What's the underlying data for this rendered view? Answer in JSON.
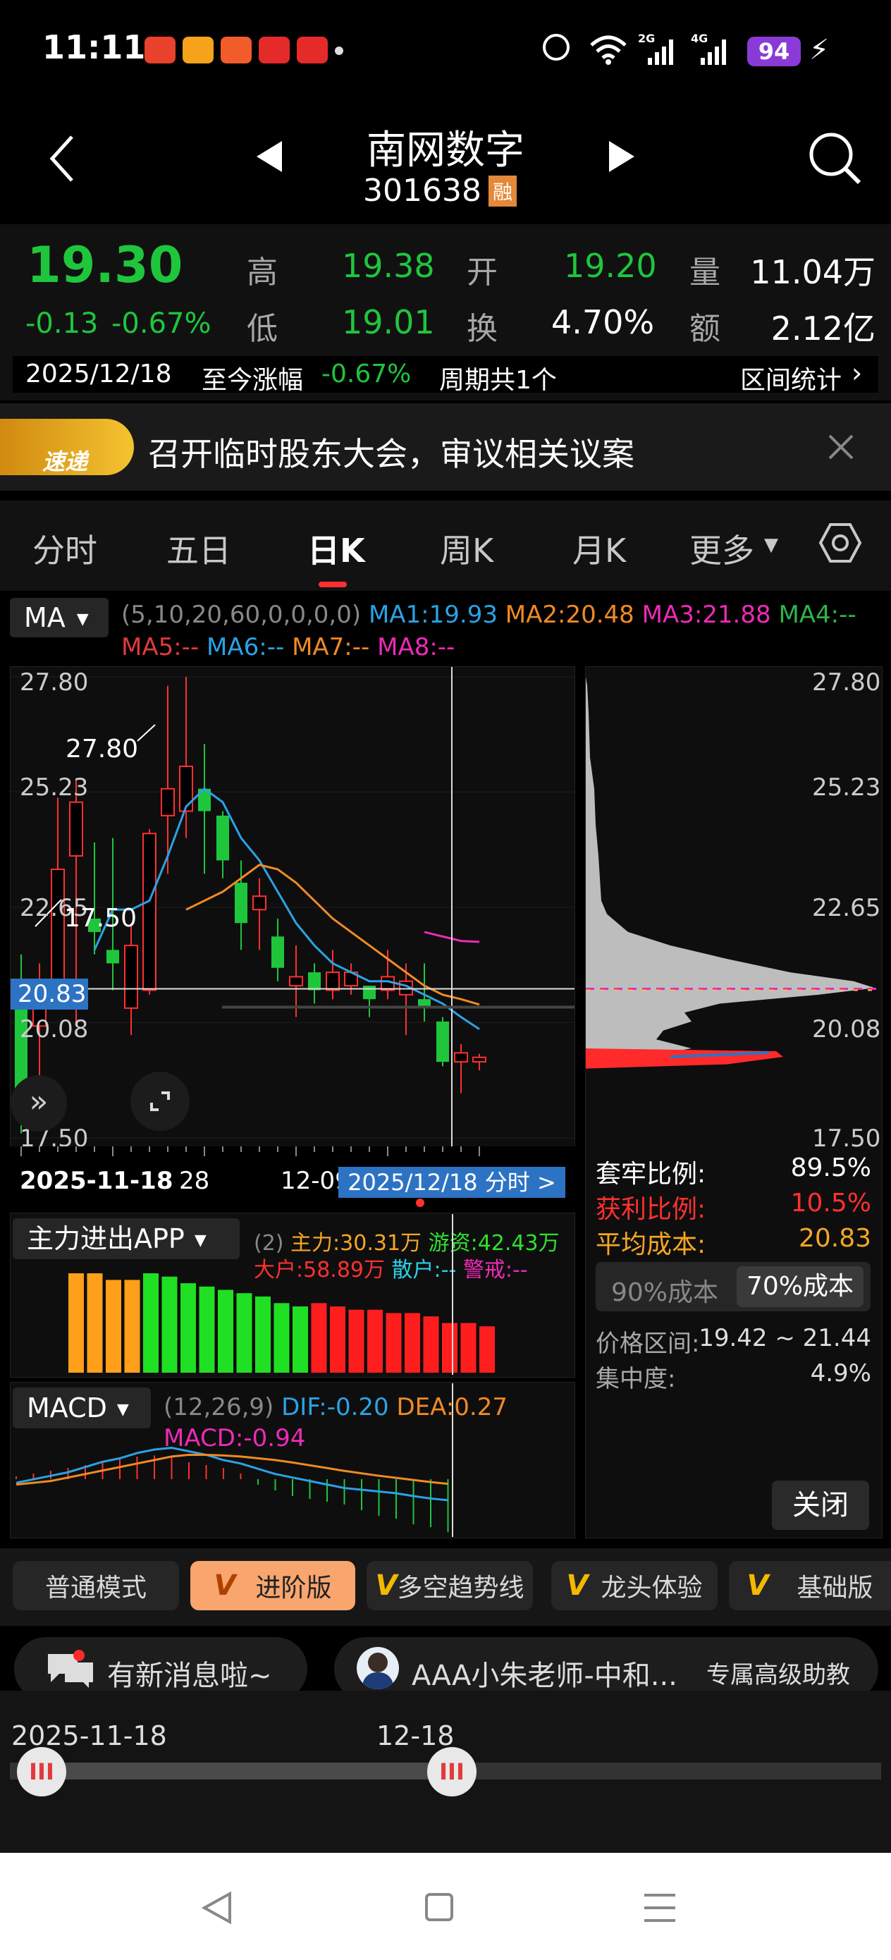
{
  "status_bar": {
    "time": "11:11",
    "battery": "94"
  },
  "header": {
    "name": "南网数字",
    "code": "301638",
    "rong_badge": "融"
  },
  "quote": {
    "price": "19.30",
    "change": "-0.13",
    "change_pct": "-0.67%",
    "high_label": "高",
    "high": "19.38",
    "open_label": "开",
    "open": "19.20",
    "vol_label": "量",
    "vol": "11.04万",
    "low_label": "低",
    "low": "19.01",
    "turnover_label": "换",
    "turnover": "4.70%",
    "amount_label": "额",
    "amount": "2.12亿"
  },
  "period_bar": {
    "date": "2025/12/18",
    "label": "至今涨幅",
    "pct": "-0.67%",
    "count": "周期共1个",
    "stats": "区间统计"
  },
  "news": {
    "logo": "速递",
    "text": "召开临时股东大会，审议相关议案"
  },
  "tabs": [
    "分时",
    "五日",
    "日K",
    "周K",
    "月K",
    "更多"
  ],
  "active_tab": "日K",
  "ma": {
    "selector": "MA",
    "params": "(5,10,20,60,0,0,0,0)",
    "ma1": "MA1:19.93",
    "ma2": "MA2:20.48",
    "ma3": "MA3:21.88",
    "ma4": "MA4:--",
    "ma5": "MA5:--",
    "ma6": "MA6:--",
    "ma7": "MA7:--",
    "ma8": "MA8:--"
  },
  "kchart": {
    "y_labels": [
      "27.80",
      "25.23",
      "22.65",
      "20.08",
      "17.50"
    ],
    "cross_price": "20.83",
    "max_annot": "27.80",
    "min_annot": "17.50",
    "date_start": "2025-11-18",
    "date_mid": "28",
    "date_dec": "12-09",
    "cursor_tag": "2025/12/18 分时 >"
  },
  "chips": {
    "y_labels": [
      "27.80",
      "25.23",
      "22.65",
      "20.08",
      "17.50"
    ],
    "tao_label": "套牢比例:",
    "tao": "89.5%",
    "profit_label": "获利比例:",
    "profit": "10.5%",
    "avg_label": "平均成本:",
    "avg": "20.83",
    "btn90": "90%成本",
    "btn70": "70%成本",
    "range_label": "价格区间:",
    "range": "19.42 ~ 21.44",
    "conc_label": "集中度:",
    "conc": "4.9%",
    "close": "关闭"
  },
  "funds": {
    "selector": "主力进出APP",
    "param": "(2)",
    "main": "主力:30.31万",
    "hot": "游资:42.43万",
    "big": "大户:58.89万",
    "retail": "散户:--",
    "warn": "警戒:--"
  },
  "macd": {
    "selector": "MACD",
    "param": "(12,26,9)",
    "dif": "DIF:-0.20",
    "dea": "DEA:0.27",
    "macd": "MACD:-0.94"
  },
  "modes": [
    "普通模式",
    "进阶版",
    "多空趋势线",
    "龙头体验",
    "基础版"
  ],
  "msg": {
    "notice": "有新消息啦~",
    "teacher": "AAA小朱老师-中和...",
    "assistant": "专属高级助教"
  },
  "range_slider": {
    "start": "2025-11-18",
    "end": "12-18"
  },
  "chart_data": [
    {
      "type": "candlestick",
      "title": "日K",
      "ylim": [
        17.5,
        27.8
      ],
      "y_ticks": [
        27.8,
        25.23,
        22.65,
        20.08,
        17.5
      ],
      "x_labels": [
        "2025-11-18",
        "28",
        "12-09"
      ],
      "candles": [
        {
          "o": 20.4,
          "c": 18.2,
          "h": 21.6,
          "l": 17.6
        },
        {
          "o": 20.0,
          "c": 20.7,
          "h": 21.4,
          "l": 17.7
        },
        {
          "o": 20.8,
          "c": 23.5,
          "h": 25.1,
          "l": 20.4
        },
        {
          "o": 23.8,
          "c": 25.0,
          "h": 25.5,
          "l": 20.0
        },
        {
          "o": 22.4,
          "c": 22.1,
          "h": 24.1,
          "l": 21.6
        },
        {
          "o": 21.7,
          "c": 21.4,
          "h": 24.2,
          "l": 20.8
        },
        {
          "o": 20.4,
          "c": 21.8,
          "h": 22.3,
          "l": 19.8
        },
        {
          "o": 20.8,
          "c": 24.3,
          "h": 24.4,
          "l": 20.7
        },
        {
          "o": 24.7,
          "c": 25.3,
          "h": 27.6,
          "l": 23.4
        },
        {
          "o": 24.8,
          "c": 25.8,
          "h": 27.8,
          "l": 24.2
        },
        {
          "o": 25.3,
          "c": 24.8,
          "h": 26.3,
          "l": 23.4
        },
        {
          "o": 24.7,
          "c": 23.7,
          "h": 24.8,
          "l": 23.3
        },
        {
          "o": 23.2,
          "c": 22.3,
          "h": 23.7,
          "l": 21.7
        },
        {
          "o": 22.6,
          "c": 22.9,
          "h": 23.3,
          "l": 21.7
        },
        {
          "o": 22.0,
          "c": 21.3,
          "h": 22.4,
          "l": 21.0
        },
        {
          "o": 20.9,
          "c": 21.1,
          "h": 21.8,
          "l": 20.2
        },
        {
          "o": 21.2,
          "c": 20.8,
          "h": 21.4,
          "l": 20.5
        },
        {
          "o": 20.8,
          "c": 21.2,
          "h": 21.7,
          "l": 20.6
        },
        {
          "o": 20.9,
          "c": 21.2,
          "h": 21.4,
          "l": 20.7
        },
        {
          "o": 20.9,
          "c": 20.6,
          "h": 20.9,
          "l": 20.2
        },
        {
          "o": 20.8,
          "c": 21.1,
          "h": 21.7,
          "l": 20.6
        },
        {
          "o": 20.7,
          "c": 21.0,
          "h": 21.4,
          "l": 19.8
        },
        {
          "o": 20.6,
          "c": 20.4,
          "h": 21.4,
          "l": 20.1
        },
        {
          "o": 20.1,
          "c": 19.2,
          "h": 20.2,
          "l": 19.1
        },
        {
          "o": 19.2,
          "c": 19.4,
          "h": 19.6,
          "l": 18.5
        },
        {
          "o": 19.2,
          "c": 19.3,
          "h": 19.38,
          "l": 19.01
        }
      ],
      "ma5": [
        null,
        null,
        null,
        null,
        21.7,
        22.6,
        22.6,
        22.8,
        23.8,
        24.9,
        25.3,
        25.0,
        24.2,
        23.7,
        23.0,
        22.3,
        21.8,
        21.4,
        21.2,
        21.0,
        21.0,
        20.9,
        20.7,
        20.5,
        20.2,
        19.93
      ],
      "ma10": [
        null,
        null,
        null,
        null,
        null,
        null,
        null,
        null,
        null,
        22.6,
        22.8,
        23.0,
        23.3,
        23.6,
        23.5,
        23.2,
        22.8,
        22.4,
        22.1,
        21.8,
        21.5,
        21.2,
        20.9,
        20.7,
        20.6,
        20.48
      ],
      "ma20": [
        null,
        null,
        null,
        null,
        null,
        null,
        null,
        null,
        null,
        null,
        null,
        null,
        null,
        null,
        null,
        null,
        null,
        null,
        null,
        null,
        null,
        null,
        22.1,
        22.0,
        21.9,
        21.88
      ]
    },
    {
      "type": "bar",
      "title": "主力进出APP",
      "values": [
        30,
        30,
        28,
        28,
        30,
        29,
        27,
        26,
        25,
        24,
        23,
        21,
        20,
        21,
        20,
        19,
        19,
        18,
        18,
        17,
        15,
        15,
        14
      ],
      "colors": [
        "orange",
        "orange",
        "orange",
        "orange",
        "green",
        "green",
        "green",
        "green",
        "green",
        "green",
        "green",
        "green",
        "green",
        "red",
        "red",
        "red",
        "red",
        "red",
        "red",
        "red",
        "red",
        "red",
        "red"
      ]
    },
    {
      "type": "bar",
      "title": "MACD",
      "values": [
        0.05,
        0.1,
        0.15,
        0.2,
        0.25,
        0.3,
        0.35,
        0.4,
        0.42,
        0.4,
        0.3,
        0.25,
        0.2,
        0.1,
        -0.1,
        -0.2,
        -0.3,
        -0.35,
        -0.4,
        -0.45,
        -0.55,
        -0.65,
        -0.7,
        -0.8,
        -0.85,
        -0.94
      ],
      "dif": [
        0.3,
        0.4,
        0.5,
        0.6,
        0.75,
        0.9,
        1.0,
        1.15,
        1.25,
        1.3,
        1.2,
        1.1,
        0.95,
        0.85,
        0.7,
        0.55,
        0.45,
        0.35,
        0.25,
        0.15,
        0.1,
        0.05,
        0.0,
        -0.08,
        -0.15,
        -0.2
      ],
      "dea": [
        0.25,
        0.3,
        0.35,
        0.45,
        0.55,
        0.65,
        0.75,
        0.85,
        0.95,
        1.05,
        1.1,
        1.1,
        1.08,
        1.05,
        1.0,
        0.95,
        0.88,
        0.8,
        0.72,
        0.64,
        0.57,
        0.5,
        0.44,
        0.38,
        0.32,
        0.27
      ]
    }
  ]
}
